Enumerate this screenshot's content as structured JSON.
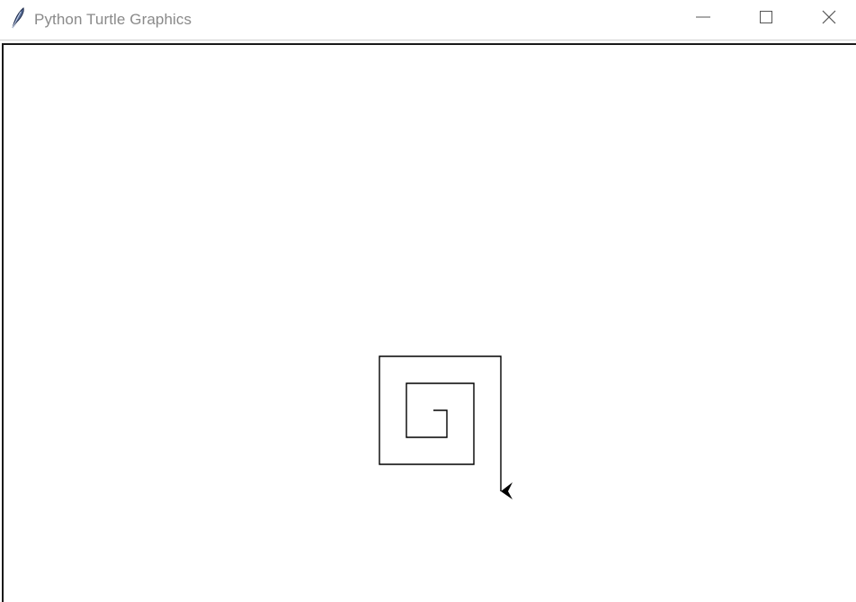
{
  "window": {
    "title": "Python Turtle Graphics",
    "icon": "feather-icon",
    "controls": {
      "minimize_icon": "minimize-icon",
      "maximize_icon": "maximize-icon",
      "close_icon": "close-icon"
    }
  },
  "canvas": {
    "background": "#ffffff",
    "pen_color": "#000000",
    "turtle_color": "#000000",
    "turtle_heading": "west"
  }
}
